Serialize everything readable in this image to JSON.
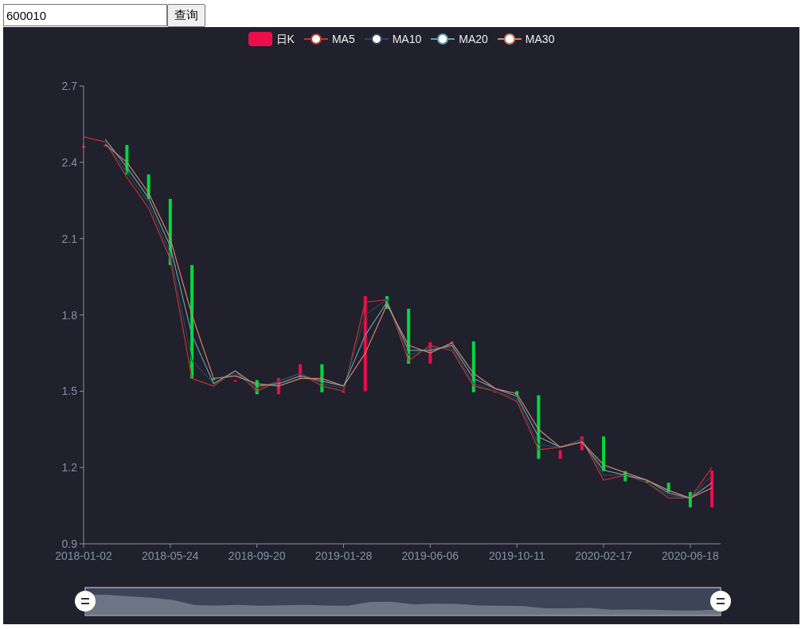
{
  "query": {
    "value": "600010"
  },
  "search_button": "查询",
  "chart": {
    "candlestick": {
      "name": "日K",
      "color": "#ec0e4c"
    },
    "chart_data": {
      "type": "line",
      "categories": [
        "2018-01-02",
        null,
        null,
        null,
        "2018-05-24",
        null,
        null,
        null,
        "2018-09-20",
        null,
        null,
        null,
        "2019-01-28",
        null,
        null,
        null,
        "2019-06-06",
        null,
        null,
        null,
        "2019-10-11",
        null,
        null,
        null,
        "2020-02-17",
        null,
        null,
        null,
        "2020-06-18",
        null
      ],
      "ylim": [
        0.9,
        2.7
      ],
      "yticks": [
        0.9,
        1.2,
        1.5,
        1.8,
        2.1,
        2.4,
        2.7
      ],
      "series": [
        {
          "name": "MA5",
          "color": "#c23531",
          "values": [
            2.5,
            2.48,
            2.34,
            2.22,
            2.02,
            1.55,
            1.52,
            1.58,
            1.5,
            1.54,
            1.57,
            1.52,
            1.5,
            1.85,
            1.86,
            1.62,
            1.68,
            1.66,
            1.52,
            1.5,
            1.46,
            1.27,
            1.28,
            1.31,
            1.15,
            1.17,
            1.14,
            1.08,
            1.08,
            1.2
          ]
        },
        {
          "name": "MA10",
          "color": "#2f4554",
          "values": [
            null,
            2.48,
            2.36,
            2.24,
            2.04,
            1.62,
            1.53,
            1.57,
            1.51,
            1.54,
            1.57,
            1.53,
            1.51,
            1.8,
            1.86,
            1.64,
            1.67,
            1.67,
            1.53,
            1.5,
            1.47,
            1.29,
            1.28,
            1.31,
            1.17,
            1.17,
            1.14,
            1.09,
            1.08,
            1.17
          ]
        },
        {
          "name": "MA20",
          "color": "#61a0a8",
          "values": [
            null,
            2.49,
            2.38,
            2.26,
            2.07,
            1.72,
            1.53,
            1.58,
            1.52,
            1.53,
            1.56,
            1.54,
            1.52,
            1.72,
            1.85,
            1.66,
            1.66,
            1.68,
            1.55,
            1.51,
            1.48,
            1.32,
            1.28,
            1.3,
            1.19,
            1.17,
            1.15,
            1.1,
            1.08,
            1.14
          ]
        },
        {
          "name": "MA30",
          "color": "#d48265",
          "values": [
            null,
            2.47,
            2.4,
            2.28,
            2.1,
            1.8,
            1.55,
            1.56,
            1.53,
            1.52,
            1.55,
            1.55,
            1.52,
            1.65,
            1.84,
            1.68,
            1.65,
            1.69,
            1.57,
            1.51,
            1.49,
            1.35,
            1.28,
            1.3,
            1.21,
            1.18,
            1.15,
            1.11,
            1.08,
            1.12
          ]
        }
      ]
    }
  }
}
